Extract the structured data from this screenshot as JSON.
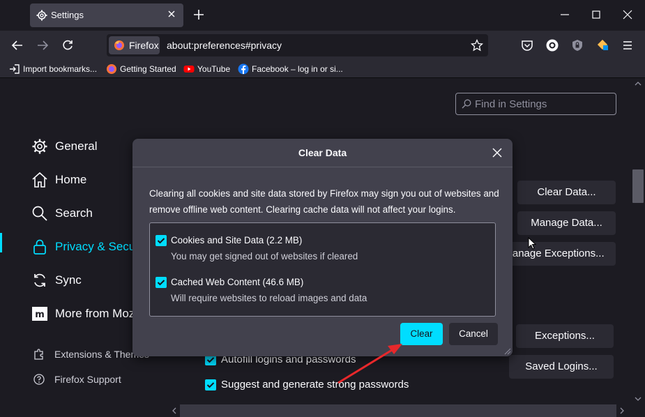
{
  "tab": {
    "title": "Settings"
  },
  "urlbar": {
    "identity": "Firefox",
    "url": "about:preferences#privacy"
  },
  "bookmarks": [
    {
      "label": "Import bookmarks...",
      "icon": "import-icon"
    },
    {
      "label": "Getting Started",
      "icon": "firefox-icon"
    },
    {
      "label": "YouTube",
      "icon": "youtube-icon"
    },
    {
      "label": "Facebook – log in or si...",
      "icon": "facebook-icon"
    }
  ],
  "search": {
    "placeholder": "Find in Settings"
  },
  "sidebar": {
    "items": [
      {
        "label": "General",
        "icon": "gear-icon"
      },
      {
        "label": "Home",
        "icon": "home-icon"
      },
      {
        "label": "Search",
        "icon": "search-icon"
      },
      {
        "label": "Privacy & Security",
        "icon": "lock-icon",
        "selected": true
      },
      {
        "label": "Sync",
        "icon": "sync-icon"
      },
      {
        "label": "More from Mozilla",
        "icon": "mozilla-icon"
      }
    ],
    "footer": [
      {
        "label": "Extensions & Themes",
        "icon": "puzzle-icon"
      },
      {
        "label": "Firefox Support",
        "icon": "help-icon"
      }
    ]
  },
  "main": {
    "buttons": {
      "clear_data": "Clear Data...",
      "manage_data": "Manage Data...",
      "manage_exceptions": "Manage Exceptions...",
      "exceptions": "Exceptions...",
      "saved_logins": "Saved Logins..."
    },
    "checkboxes": [
      {
        "label": "Autofill logins and passwords",
        "checked": true
      },
      {
        "label": "Suggest and generate strong passwords",
        "checked": true
      }
    ]
  },
  "dialog": {
    "title": "Clear Data",
    "description": "Clearing all cookies and site data stored by Firefox may sign you out of websites and remove offline web content. Clearing cache data will not affect your logins.",
    "options": [
      {
        "label": "Cookies and Site Data (2.2 MB)",
        "sub": "You may get signed out of websites if cleared",
        "checked": true
      },
      {
        "label": "Cached Web Content (46.6 MB)",
        "sub": "Will require websites to reload images and data",
        "checked": true
      }
    ],
    "clear_label": "Clear",
    "cancel_label": "Cancel"
  },
  "colors": {
    "accent": "#00ddff",
    "dialog_bg": "#42414d",
    "page_bg": "#1c1b22",
    "arrow": "#e8282b"
  }
}
